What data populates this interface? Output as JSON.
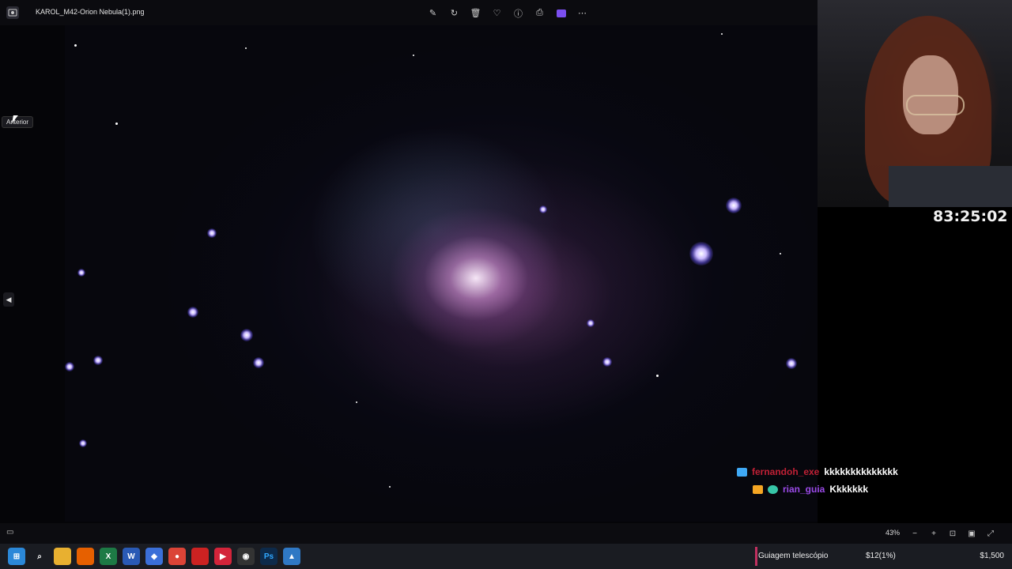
{
  "window": {
    "title": "KAROL_M42-Orion Nebula(1).png"
  },
  "toolbar": {
    "icons": [
      "edit-icon",
      "rotate-icon",
      "delete-icon",
      "favorite-icon",
      "info-icon",
      "print-icon",
      "editor-app-icon",
      "more-icon"
    ]
  },
  "viewer": {
    "tooltip": "Anterior"
  },
  "overlay": {
    "timer": "83:25:02"
  },
  "chat": [
    {
      "user": "fernandoh_exe",
      "message": "kkkkkkkkkkkkkk"
    },
    {
      "user": "rian_guia",
      "message": "Kkkkkkk"
    }
  ],
  "statusbar": {
    "zoom": "43%"
  },
  "goal": {
    "label": "Guiagem telescópio",
    "raised": "$12(1%)",
    "target": "$1,500"
  },
  "colors": {
    "user1": "#c02035",
    "user2": "#9b4ae8",
    "accent": "#c03060"
  }
}
